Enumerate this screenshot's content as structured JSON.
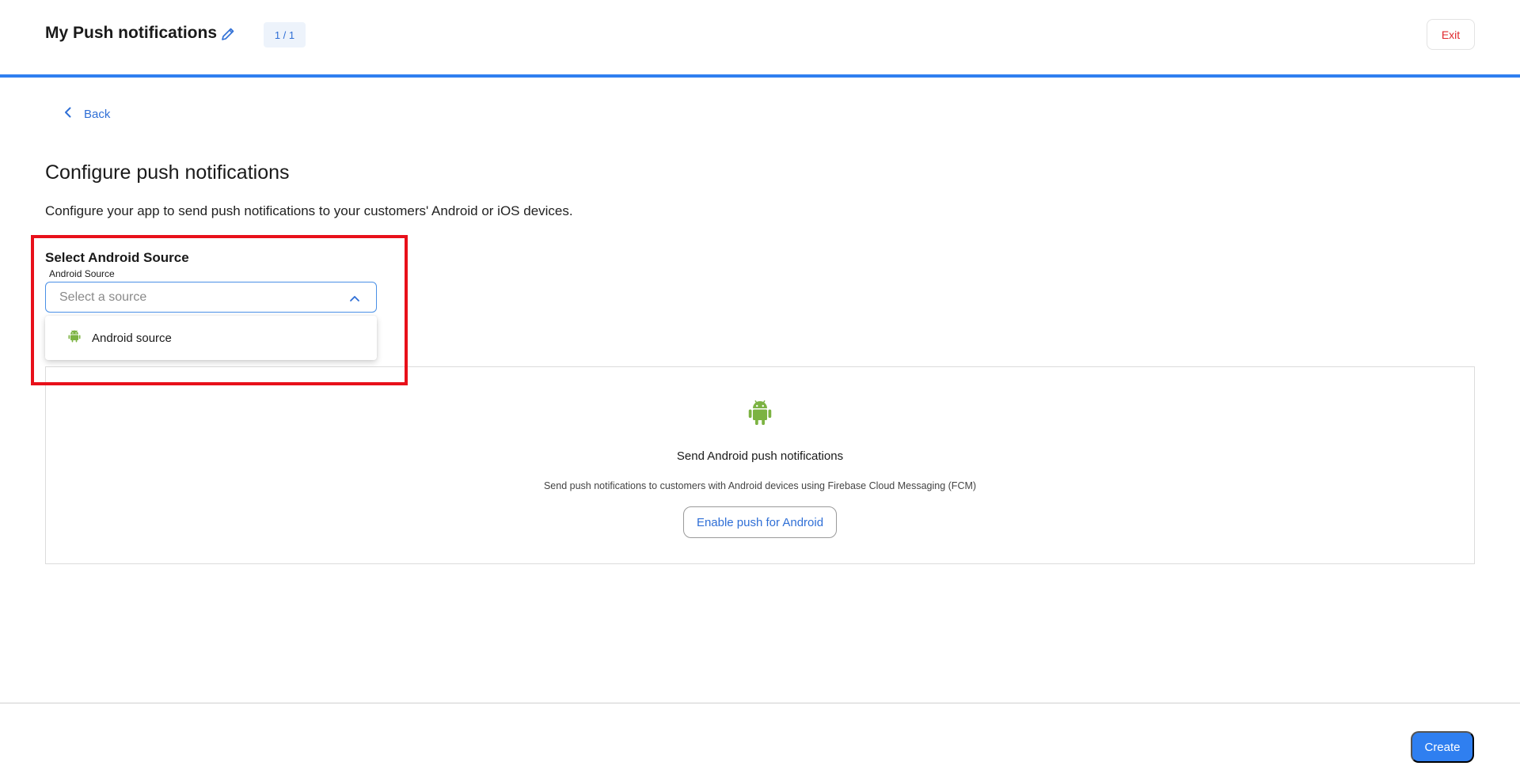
{
  "header": {
    "title": "My Push notifications",
    "edit_icon": "pencil-icon",
    "counter": "1 / 1",
    "exit_label": "Exit"
  },
  "nav": {
    "back_label": "Back",
    "back_icon": "chevron-left-icon"
  },
  "main": {
    "title": "Configure push notifications",
    "description": "Configure your app to send push notifications to your customers' Android or iOS devices."
  },
  "source_select": {
    "heading": "Select Android Source",
    "label": "Android Source",
    "placeholder": "Select a source",
    "expanded": true,
    "options": [
      {
        "label": "Android source",
        "icon": "android-icon"
      }
    ]
  },
  "android_card": {
    "icon": "android-icon",
    "title": "Send Android push notifications",
    "description": "Send push notifications to customers with Android devices using Firebase Cloud Messaging (FCM)",
    "button_label": "Enable push for Android"
  },
  "footer": {
    "create_label": "Create"
  },
  "colors": {
    "accent": "#2f7ff0",
    "exit": "#e0282d",
    "android_green": "#7cb342",
    "highlight": "#e8101a"
  }
}
